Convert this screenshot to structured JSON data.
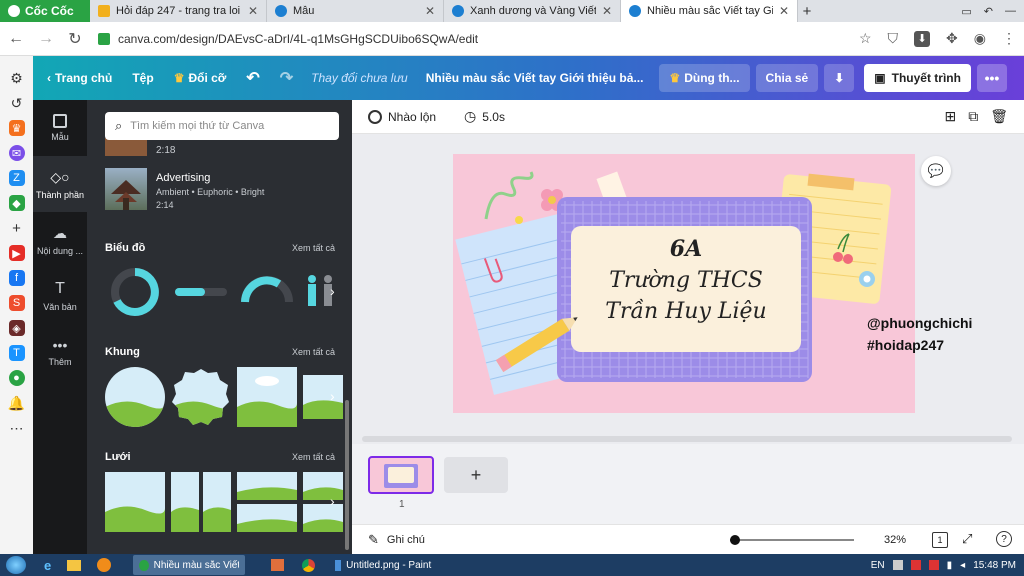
{
  "browser": {
    "brand": "Cốc Cốc",
    "tabs": [
      {
        "title": "Hỏi đáp 247 - trang tra loi",
        "favicon_color": "#f2b01e"
      },
      {
        "title": "Mẫu",
        "favicon_color": "#1d7fd1"
      },
      {
        "title": "Xanh dương và Vàng Viết tay",
        "favicon_color": "#1d7fd1"
      },
      {
        "title": "Nhiều màu sắc Viết tay Giới t",
        "favicon_color": "#1d7fd1"
      }
    ],
    "url": "canva.com/design/DAEvsC-aDrI/4L-q1MsGHgSCDUibo6SQwA/edit"
  },
  "canva_header": {
    "home": "Trang chủ",
    "file": "Tệp",
    "resize": "Đổi cỡ",
    "unsaved": "Thay đổi chưa lưu",
    "doc_title": "Nhiều màu sắc Viết tay Giới thiệu bả...",
    "try_pro": "Dùng th...",
    "share": "Chia sẻ",
    "present": "Thuyết trình"
  },
  "side_nav": [
    {
      "label": "Mẫu",
      "icon": "template-icon"
    },
    {
      "label": "Thành phần",
      "icon": "elements-icon"
    },
    {
      "label": "Nội dung ...",
      "icon": "upload-icon"
    },
    {
      "label": "Văn bản",
      "icon": "text-icon"
    },
    {
      "label": "Thêm",
      "icon": "more-icon"
    }
  ],
  "panel": {
    "search_placeholder": "Tìm kiếm mọi thứ từ Canva",
    "prev_duration": "2:18",
    "audio": {
      "title": "Advertising",
      "tags": "Ambient • Euphoric • Bright",
      "duration": "2:14"
    },
    "charts": {
      "title": "Biểu đồ",
      "see_all": "Xem tất cả"
    },
    "frames": {
      "title": "Khung",
      "see_all": "Xem tất cả"
    },
    "grids": {
      "title": "Lưới",
      "see_all": "Xem tất cả"
    }
  },
  "editor": {
    "shuffle": "Nhào lộn",
    "duration": "5.0s",
    "slide": {
      "line1": "6A",
      "line2": "Trường THCS",
      "line3": "Trần Huy Liệu"
    },
    "watermark": {
      "line1": "@phuongchichi",
      "line2": "#hoidap247"
    },
    "page_number": "1",
    "notes": "Ghi chú",
    "zoom": "32%",
    "page_count": "1"
  },
  "taskbar": {
    "items": [
      "Nhiều màu sắc Viết t...",
      "Untitled.png - Paint"
    ],
    "lang": "EN",
    "time": "15:48 PM"
  },
  "colors": {
    "slide_bg": "#f8c7d8",
    "grid_paper": "#9c8ce8",
    "text_box": "#fbf0dc",
    "header_start": "#12a7b5",
    "header_end": "#6a3fd9"
  }
}
